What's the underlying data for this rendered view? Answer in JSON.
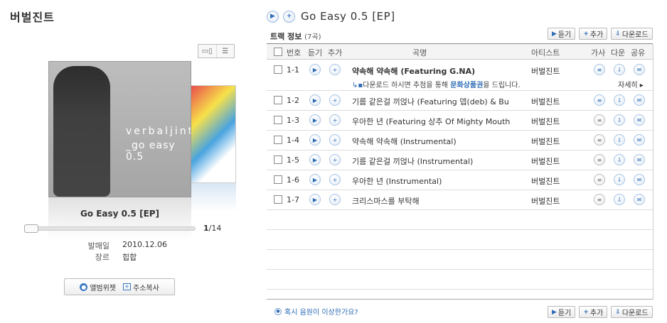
{
  "artist_name": "버벌진트",
  "album": {
    "title": "Go Easy 0.5 [EP]",
    "cover_line1": "verbaljint",
    "cover_line2": "_go easy 0.5",
    "page_current": "1",
    "page_total": "/14",
    "release_label": "발매일",
    "release_date": "2010.12.06",
    "genre_label": "장르",
    "genre": "힙합"
  },
  "widget": {
    "album_widget": "앨범위젯",
    "copy_address": "주소복사"
  },
  "header": {
    "play_icon": "play-icon",
    "add_icon": "plus-icon",
    "title": "Go Easy 0.5 [EP]"
  },
  "track_info": {
    "label": "트랙 정보",
    "count": "(7곡)"
  },
  "actions": {
    "listen": "듣기",
    "add": "추가",
    "download": "다운로드"
  },
  "columns": {
    "number": "번호",
    "listen": "듣기",
    "add": "추가",
    "song": "곡명",
    "artist": "아티스트",
    "lyrics": "가사",
    "download": "다운",
    "share": "공유"
  },
  "promo": {
    "prefix": "다운로드 하시면 추첨을 통해 ",
    "highlight": "문화상품권",
    "suffix": "을 드립니다.",
    "more": "자세히"
  },
  "tracks": [
    {
      "num": "1-1",
      "title": "약속해 약속해 (Featuring G.NA)",
      "artist": "버벌진트"
    },
    {
      "num": "1-2",
      "title": "기름 같은걸 끼얹나 (Featuring 뎁(deb) & Bu",
      "artist": "버벌진트"
    },
    {
      "num": "1-3",
      "title": "우아한 년 (Featuring 상추 Of Mighty Mouth",
      "artist": "버벌진트"
    },
    {
      "num": "1-4",
      "title": "약속해 약속해 (Instrumental)",
      "artist": "버벌진트"
    },
    {
      "num": "1-5",
      "title": "기름 같은걸 끼얹나 (Instrumental)",
      "artist": "버벌진트"
    },
    {
      "num": "1-6",
      "title": "우아한 년 (Instrumental)",
      "artist": "버벌진트"
    },
    {
      "num": "1-7",
      "title": "크리스마스를 부탁해",
      "artist": "버벌진트"
    }
  ],
  "report": "혹시 음원이 이상한가요?",
  "colors": {
    "accent_blue": "#2f6db5",
    "border_gray": "#cccccc"
  }
}
